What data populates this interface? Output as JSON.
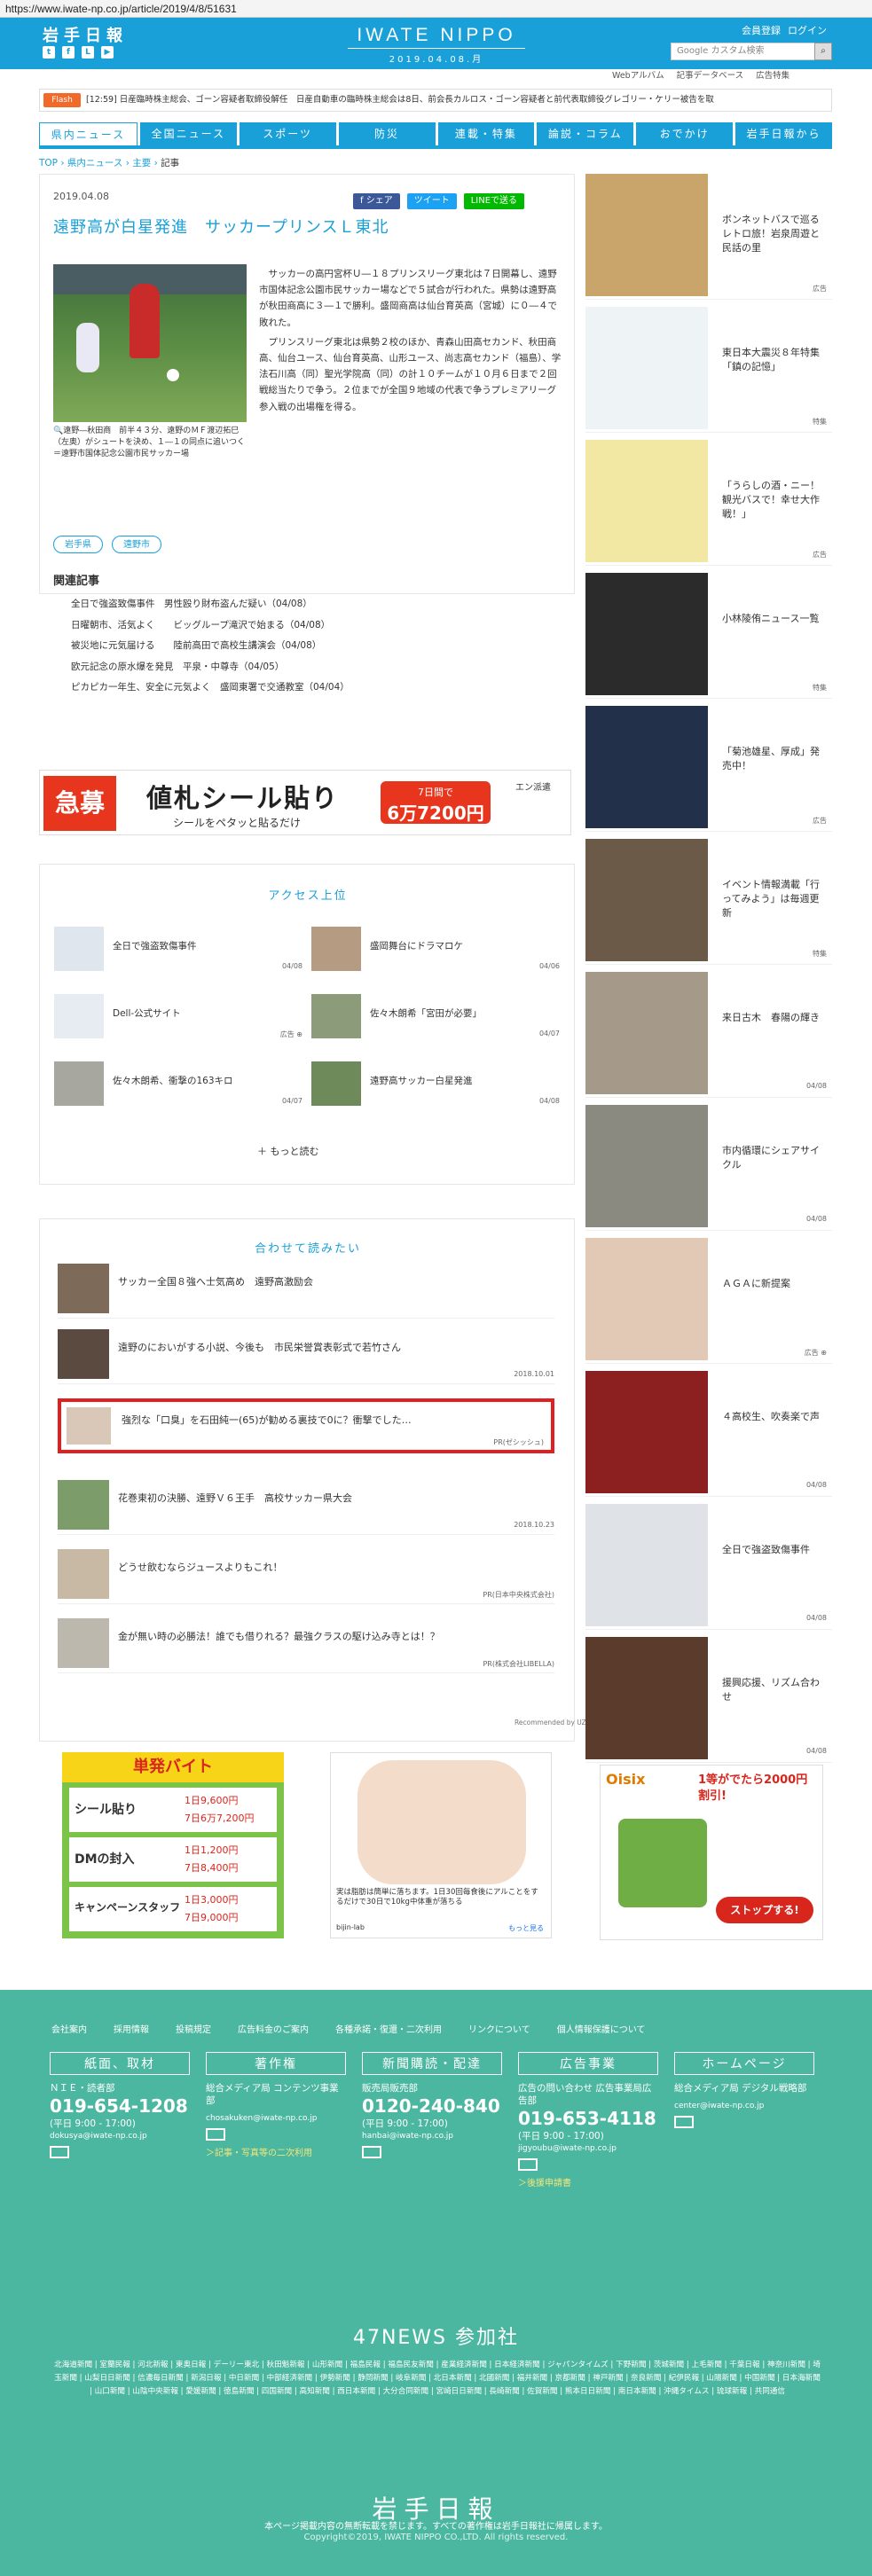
{
  "browser": {
    "url": "https://www.iwate-np.co.jp/article/2019/4/8/51631"
  },
  "header": {
    "logo_small": "岩手日報",
    "brand": "IWATE NIPPO",
    "date": "2019.04.08.月",
    "user_links": [
      "会員登録",
      "ログイン"
    ],
    "search_placeholder": "Google カスタム検索",
    "sub_links": [
      "Webアルバム",
      "記事データベース",
      "広告特集"
    ]
  },
  "flash": {
    "label": "Flash",
    "text": "[12:59] 日産臨時株主総会、ゴーン容疑者取締役解任　日産自動車の臨時株主総会は8日、前会長カルロス・ゴーン容疑者と前代表取締役グレゴリー・ケリー被告を取"
  },
  "nav": {
    "items": [
      "県内ニュース",
      "全国ニュース",
      "スポーツ",
      "防災",
      "連載・特集",
      "論説・コラム",
      "おでかけ",
      "岩手日報から"
    ]
  },
  "breadcrumb": {
    "top": "TOP",
    "sep": " › ",
    "c1": "県内ニュース",
    "c2": "主要",
    "current": "記事"
  },
  "article": {
    "date": "2019.04.08",
    "share": [
      "f シェア",
      "ツイート",
      "LINEで送る"
    ],
    "title": "遠野高が白星発進　サッカープリンスＬ東北",
    "caption": "遠野―秋田商　前半４３分、遠野のＭＦ渡辺拓巳（左奥）がシュートを決め、１―１の同点に追いつく＝遠野市国体記念公園市民サッカー場",
    "paragraph1": "　サッカーの高円宮杯Ｕ―１８プリンスリーグ東北は７日開幕し、遠野市国体記念公園市民サッカー場などで５試合が行われた。県勢は遠野高が秋田商高に３―１で勝利。盛岡商高は仙台育英高（宮城）に０―４で敗れた。",
    "paragraph2": "　プリンスリーグ東北は県勢２校のほか、青森山田高セカンド、秋田商高、仙台ユース、仙台育英高、山形ユース、尚志高セカンド（福島）、学法石川高（同）聖光学院高（同）の計１０チームが１０月６日まで２回戦総当たりで争う。２位までが全国９地域の代表で争うプレミアリーグ参入戦の出場権を得る。",
    "tags": [
      "岩手県",
      "遠野市"
    ],
    "related_heading": "関連記事",
    "related": [
      "全日で強盗致傷事件　男性殴り財布盗んだ疑い（04/08）",
      "日曜朝市、活気よく　　ビッグループ滝沢で始まる（04/08）",
      "被災地に元気届ける　　陸前高田で高校生講演会（04/08）",
      "欧元記念の原水爆を発見　平泉・中尊寺（04/05）",
      "ピカピカ一年生、安全に元気よく　盛岡東署で交通教室（04/04）"
    ]
  },
  "ad_banner": {
    "left": "急募",
    "main": "値札シール貼り",
    "sub": "シールをペタッと貼るだけ",
    "pay_label": "7日間で",
    "pay": "6万7200円",
    "brand": "エン派遣"
  },
  "access": {
    "title": "アクセス上位",
    "items": [
      {
        "title": "全日で強盗致傷事件",
        "date": "04/08"
      },
      {
        "title": "盛岡舞台にドラマロケ",
        "date": "04/06"
      },
      {
        "title": "Dell-公式サイト",
        "date": "広告 ⊕"
      },
      {
        "title": "佐々木朗希「宮田が必要」",
        "date": "04/07"
      },
      {
        "title": "佐々木朗希、衝撃の163キロ",
        "date": "04/07"
      },
      {
        "title": "遠野高サッカー白星発進",
        "date": "04/08"
      }
    ],
    "more": "＋ もっと読む"
  },
  "recommend": {
    "title": "合わせて読みたい",
    "items": [
      {
        "title": "サッカー全国８強へ士気高め　遠野高激励会",
        "date": ""
      },
      {
        "title": "遠野のにおいがする小説、今後も　市民栄誉賞表彰式で若竹さん",
        "date": "2018.10.01"
      },
      {
        "title": "強烈な「口臭」を石田純一(65)が勧める裏技で0に？衝撃でした…",
        "date": "PR(ゼシッシュ)"
      },
      {
        "title": "花巻東初の決勝、遠野Ｖ６王手　高校サッカー県大会",
        "date": "2018.10.23"
      },
      {
        "title": "どうせ飲むならジュースよりもこれ！",
        "date": "PR(日本中央株式会社)"
      },
      {
        "title": "金が無い時の必勝法！誰でも借りれる？最強クラスの駆け込み寺とは！？",
        "date": "PR(株式会社LIBELLA)"
      }
    ],
    "credit": "Recommended by UZOU"
  },
  "bottom_ads": {
    "ad3_title": "単発バイト",
    "ad3_rows": [
      [
        "シール貼り",
        "1日9,600円",
        "7日6万7,200円"
      ],
      [
        "DMの封入",
        "1日1,200円",
        "7日8,400円"
      ],
      [
        "キャンペーンスタッフ",
        "1日3,000円",
        "7日9,000円"
      ]
    ],
    "ad4_text": "実は脂肪は簡単に落ちます。1日30回毎食後にアルことをするだけで30日で10kg中体重が落ちる",
    "ad4_brand": "bijin-lab",
    "ad4_more": "もっと見る",
    "ad5_brand": "Oisix",
    "ad5_headline": "1等がでたら2000円割引!",
    "ad5_cta": "ストップする!"
  },
  "sidebar": {
    "items": [
      {
        "title": "ボンネットバスで巡るレトロ旅！岩泉周遊と民話の里",
        "date": "広告"
      },
      {
        "title": "東日本大震災８年特集「鎮の記憶」",
        "date": "特集"
      },
      {
        "title": "「うらしの酒・ニー！観光バスで！幸せ大作戦！」",
        "date": "広告"
      },
      {
        "title": "小林陵侑ニュース一覧",
        "date": "特集"
      },
      {
        "title": "「菊池雄星、厚成」発売中！",
        "date": "広告"
      },
      {
        "title": "イベント情報満載「行ってみよう」は毎週更新",
        "date": "特集"
      },
      {
        "title": "来日古木　春陽の輝き",
        "date": "04/08"
      },
      {
        "title": "市内循環にシェアサイクル",
        "date": "04/08"
      },
      {
        "title": "ＡＧＡに新提案",
        "date": "広告 ⊕"
      },
      {
        "title": "４高校生、吹奏楽で声",
        "date": "04/08"
      },
      {
        "title": "全日で強盗致傷事件",
        "date": "04/08"
      },
      {
        "title": "援興応援、リズム合わせ",
        "date": "04/08"
      }
    ]
  },
  "footer": {
    "links": [
      "会社案内",
      "採用情報",
      "投稿規定",
      "広告料金のご案内",
      "各種承諾・復還・二次利用",
      "リンクについて",
      "個人情報保護について"
    ],
    "sections": [
      {
        "head": "紙面、取材",
        "line1": "ＮＩＥ・読者部",
        "tel": "019-654-1208",
        "hours": "(平日 9:00 - 17:00)",
        "mail": "dokusya@iwate-np.co.jp",
        "note": ""
      },
      {
        "head": "著作権",
        "line1": "総合メディア局 コンテンツ事業部",
        "tel": "",
        "hours": "",
        "mail": "chosakuken@iwate-np.co.jp",
        "note": "＞記事・写真等の二次利用"
      },
      {
        "head": "新聞購読・配達",
        "line1": "販売局販売部",
        "tel": "0120-240-840",
        "hours": "(平日 9:00 - 17:00)",
        "mail": "hanbai@iwate-np.co.jp",
        "note": ""
      },
      {
        "head": "広告事業",
        "line1": "広告の問い合わせ 広告事業局広告部",
        "tel": "019-653-4118",
        "hours": "(平日 9:00 - 17:00)",
        "mail": "jigyoubu@iwate-np.co.jp",
        "note": "＞後援申請書"
      },
      {
        "head": "ホームページ",
        "line1": "総合メディア局 デジタル戦略部",
        "tel": "",
        "hours": "",
        "mail": "center@iwate-np.co.jp",
        "note": ""
      }
    ],
    "n47_title": "47NEWS 参加社",
    "n47_list": "北海道新聞 | 室蘭民報 | 河北新報 | 東奥日報 | デーリー東北 | 秋田魁新報 | 山形新聞 | 福島民報 | 福島民友新聞 | 産業経済新聞 | 日本経済新聞 | ジャパンタイムズ | 下野新聞 | 茨城新聞 | 上毛新聞 | 千葉日報 | 神奈川新聞 | 埼玉新聞 | 山梨日日新聞 | 信濃毎日新聞 | 新潟日報 | 中日新聞 | 中部経済新聞 | 伊勢新聞 | 静岡新聞 | 岐阜新聞 | 北日本新聞 | 北國新聞 | 福井新聞 | 京都新聞 | 神戸新聞 | 奈良新聞 | 紀伊民報 | 山陽新聞 | 中国新聞 | 日本海新聞 | 山口新聞 | 山陰中央新報 | 愛媛新聞 | 徳島新聞 | 四国新聞 | 高知新聞 | 西日本新聞 | 大分合同新聞 | 宮崎日日新聞 | 長崎新聞 | 佐賀新聞 | 熊本日日新聞 | 南日本新聞 | 沖縄タイムス | 琉球新報 | 共同通信",
    "logo": "岩手日報",
    "note": "本ページ掲載内容の無断転載を禁じます。すべての著作権は岩手日報社に帰属します。",
    "copyright": "Copyright©2019, IWATE NIPPO CO.,LTD. All rights reserved."
  },
  "colors": {
    "accent": "#1aa0d8",
    "flash": "#f26a2a",
    "footer": "#4cb7a0",
    "highlight": "#e02020"
  }
}
